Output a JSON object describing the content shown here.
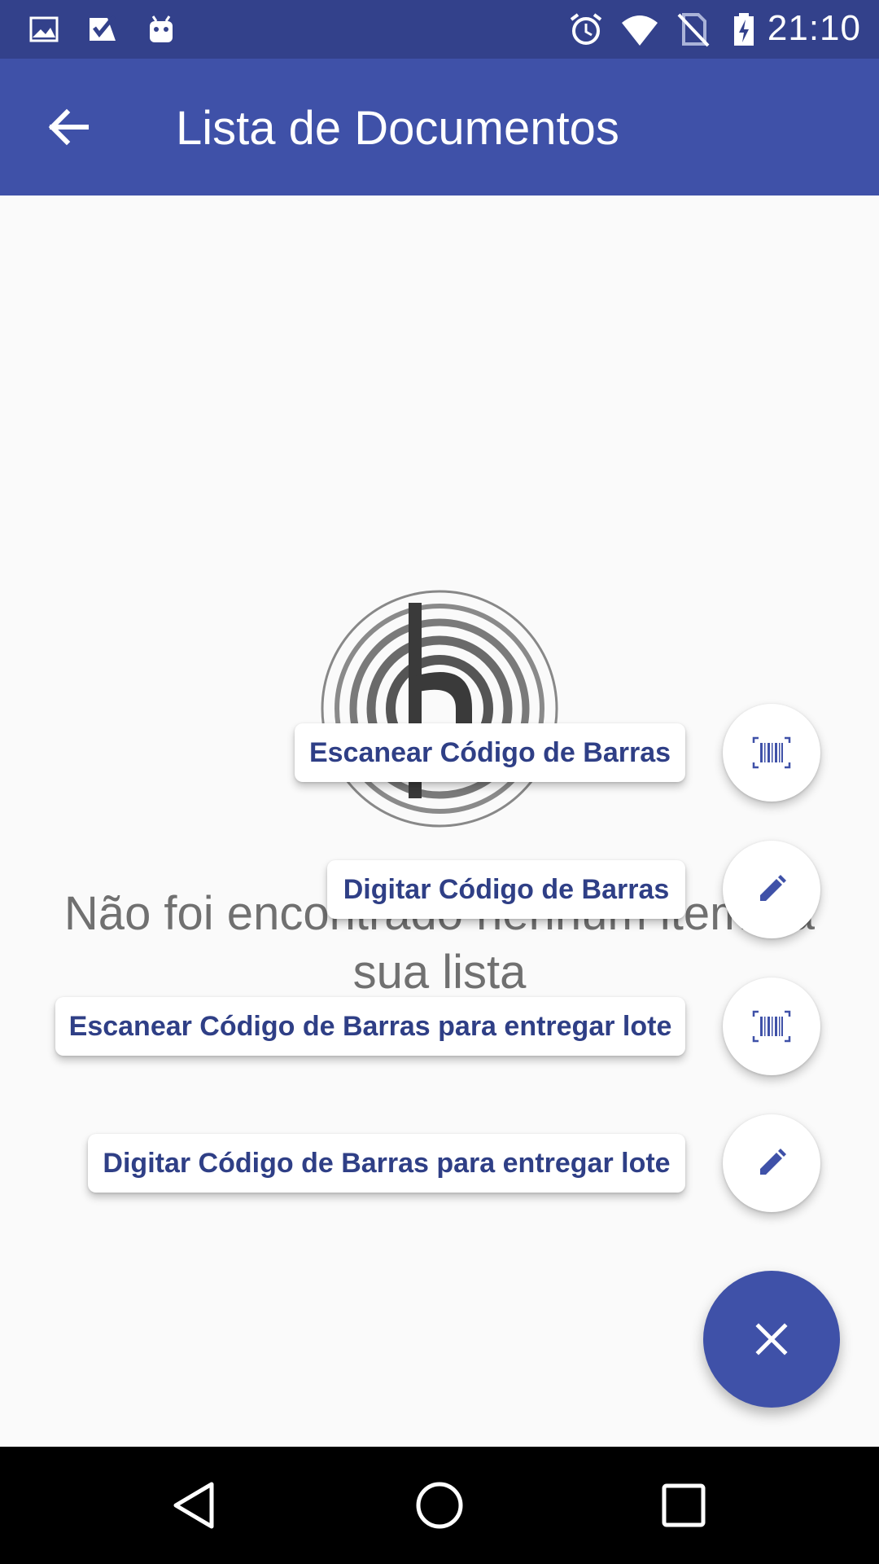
{
  "status_bar": {
    "time": "21:10",
    "left_icons": [
      "image-icon",
      "checklist-icon",
      "android-icon"
    ],
    "right_icons": [
      "alarm-icon",
      "wifi-icon",
      "no-sim-icon",
      "battery-charging-icon"
    ]
  },
  "app_bar": {
    "title": "Lista de Documentos",
    "back_icon": "arrow-back-icon"
  },
  "empty_state": {
    "message": "Não foi encontrado nenhum item na sua lista"
  },
  "fab_menu": {
    "items": [
      {
        "label": "Escanear Código de Barras",
        "icon": "barcode-icon"
      },
      {
        "label": "Digitar Código de Barras",
        "icon": "pencil-icon"
      },
      {
        "label": "Escanear Código de Barras para entregar lote",
        "icon": "barcode-icon"
      },
      {
        "label": "Digitar Código de Barras para entregar lote",
        "icon": "pencil-icon"
      }
    ],
    "main_icon": "close-icon"
  },
  "nav_bar": {
    "icons": [
      "back-triangle-icon",
      "home-circle-icon",
      "recents-square-icon"
    ]
  },
  "colors": {
    "status_bar": "#33418b",
    "app_bar": "#3f51a8",
    "accent": "#3f51a8",
    "label_text": "#2f3f86",
    "background": "#fafafa"
  }
}
